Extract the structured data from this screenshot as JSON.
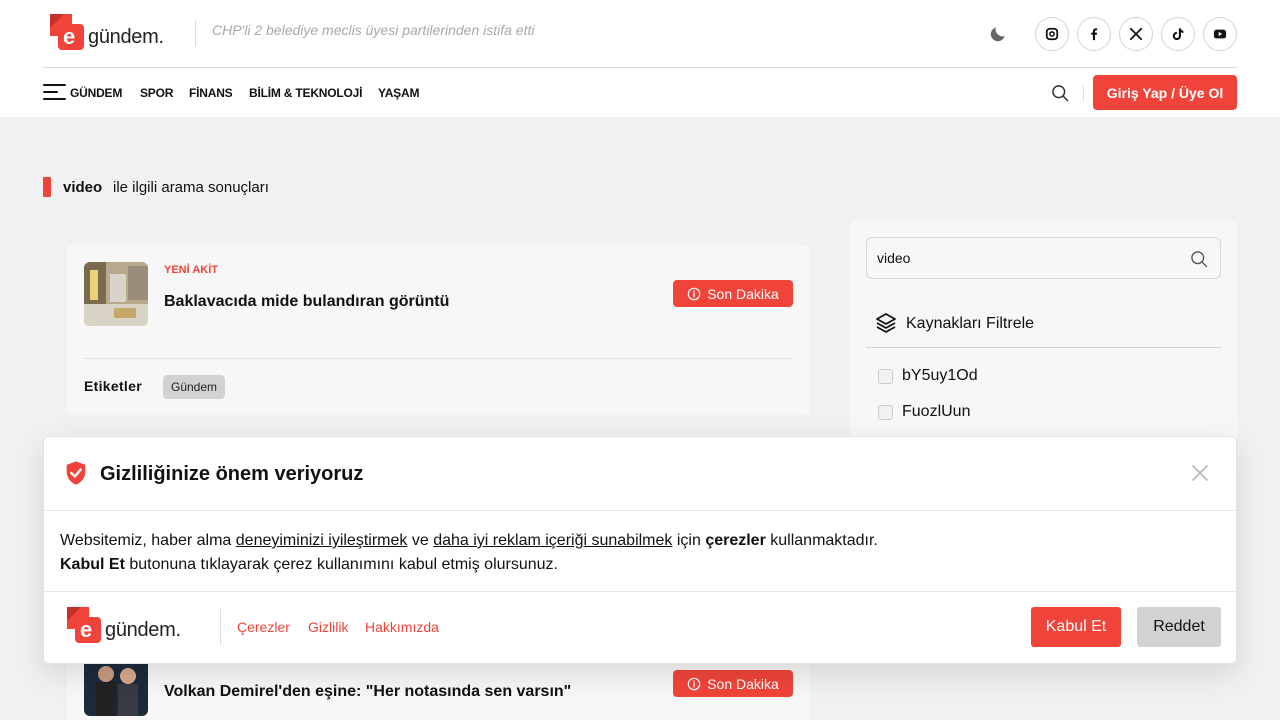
{
  "brand": {
    "logo_letter": "e",
    "logo_word": "gündem."
  },
  "header": {
    "breaking_headline": "CHP'li 2 belediye meclis üyesi partilerinden istifa etti",
    "social": [
      "instagram-icon",
      "facebook-icon",
      "x-icon",
      "tiktok-icon",
      "youtube-icon"
    ]
  },
  "nav": {
    "items": [
      "GÜNDEM",
      "SPOR",
      "FİNANS",
      "BİLİM & TEKNOLOJİ",
      "YAŞAM"
    ],
    "login_label": "Giriş Yap / Üye Ol"
  },
  "results": {
    "query": "video",
    "suffix": "ile ilgili arama sonuçları",
    "cards": [
      {
        "source": "YENİ AKİT",
        "title": "Baklavacıda mide bulandıran görüntü",
        "badge": "Son Dakika",
        "tags_label": "Etiketler",
        "tags": [
          "Gündem"
        ]
      },
      {
        "source": "",
        "title": "Volkan Demirel'den eşine: \"Her notasında sen varsın\"",
        "badge": "Son Dakika"
      }
    ]
  },
  "sidebar": {
    "search_value": "video",
    "filter_title": "Kaynakları Filtrele",
    "sources": [
      "bY5uy1Od",
      "FuozlUun"
    ]
  },
  "cookie": {
    "title": "Gizliliğinize önem veriyoruz",
    "line1_a": "Websitemiz, haber alma ",
    "line1_link1": "deneyiminizi iyileştirmek",
    "line1_b": " ve ",
    "line1_link2": "daha iyi reklam içeriği sunabilmek",
    "line1_c": " için ",
    "line1_bold": "çerezler",
    "line1_d": " kullanmaktadır.",
    "line2_bold": "Kabul Et",
    "line2_rest": " butonuna tıklayarak çerez kullanımını kabul etmiş olursunuz.",
    "links": [
      "Çerezler",
      "Gizlilik",
      "Hakkımızda"
    ],
    "accept_label": "Kabul Et",
    "reject_label": "Reddet"
  },
  "colors": {
    "accent": "#f0443a",
    "background": "#f1f1f1",
    "card": "#f7f7f7"
  }
}
